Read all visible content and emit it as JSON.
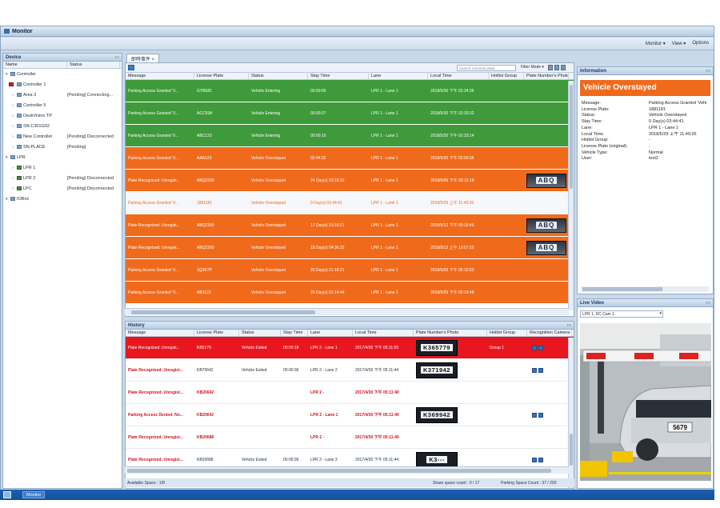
{
  "window": {
    "title": "Monitor"
  },
  "menubar": {
    "items": [
      "Monitor ▾",
      "View ▾",
      "Options"
    ]
  },
  "devices": {
    "title": "Device",
    "columns": [
      "Name",
      "Status"
    ],
    "items": [
      {
        "name": "Controller",
        "status": ""
      },
      {
        "name": "Controller 1",
        "status": ""
      },
      {
        "name": "Area 3",
        "status": "[Pending] Connecting..."
      },
      {
        "name": "Controller 5",
        "status": ""
      },
      {
        "name": "DeskVision TP",
        "status": ""
      },
      {
        "name": "SN-C301G02",
        "status": ""
      },
      {
        "name": "New Controller",
        "status": "[Pending] Disconnected"
      },
      {
        "name": "SN-PLACE",
        "status": "[Pending]"
      },
      {
        "name": "LPR",
        "status": ""
      },
      {
        "name": "LPR 1",
        "status": ""
      },
      {
        "name": "LPR 2",
        "status": "[Pending] Disconnected"
      },
      {
        "name": "LPC",
        "status": "[Pending] Disconnected"
      },
      {
        "name": "IOBox",
        "status": ""
      }
    ]
  },
  "events": {
    "tab_label": "即時事件",
    "search_placeholder": "Search a license plate...",
    "filter_label": "Filter Mode ▾",
    "columns": [
      "Message",
      "License Plate",
      "Status",
      "Stay Time",
      "Lane",
      "Local Time",
      "Hotlist Group",
      "Plate Number's Photo"
    ],
    "rows": [
      {
        "message": "Parking Access Granted 'V...",
        "plate": "GYB581",
        "status": "Vehicle Entering",
        "stay": "00:00:06",
        "lane": "LPR 1 - Lane 1",
        "time": "2018/5/30 下午 02:34:36",
        "color": "green",
        "photo": ""
      },
      {
        "message": "Parking Access Granted 'V...",
        "plate": "ACC59A",
        "status": "Vehicle Entering",
        "stay": "00:00:27",
        "lane": "LPR 1 - Lane 1",
        "time": "2018/5/30 下午 02:33:32",
        "color": "green",
        "photo": ""
      },
      {
        "message": "Parking Access Granted 'V...",
        "plate": "ABC123",
        "status": "Vehicle Entering",
        "stay": "00:00:15",
        "lane": "LPR 1 - Lane 1",
        "time": "2018/5/30 下午 02:33:14",
        "color": "green",
        "photo": ""
      },
      {
        "message": "Parking Access Granted 'V...",
        "plate": "AAA123",
        "status": "Vehicle Overstayed",
        "stay": "02:44:32",
        "lane": "LPR 1 - Lane 1",
        "time": "2018/5/30 下午 02:00:36",
        "color": "orange",
        "photo": ""
      },
      {
        "message": "Plate Recognized: Unregist...",
        "plate": "ABQ2200",
        "status": "Vehicle Overstayed",
        "stay": "24 Day(s) 23:18:32",
        "lane": "LPR 1 - Lane 1",
        "time": "2018/5/06 下午 03:15:18",
        "color": "orange",
        "photo": "ABQ"
      },
      {
        "message": "Parking Access Granted 'V...",
        "plate": "1881181",
        "status": "Vehicle Overstayed",
        "stay": "0 Day(s) 03:44:41",
        "lane": "LPR 1 - Lane 1",
        "time": "2018/5/29 上午 11:49:26",
        "color": "light",
        "photo": ""
      },
      {
        "message": "Plate Recognized: Unregist...",
        "plate": "ABQ2200",
        "status": "Vehicle Overstayed",
        "stay": "17 Day(s) 23:18:21",
        "lane": "LPR 1 - Lane 1",
        "time": "2018/5/12 下午 03:16:46",
        "color": "orange",
        "photo": "ABQ"
      },
      {
        "message": "Plate Recognized: Unregist...",
        "plate": "ABQ2200",
        "status": "Vehicle Overstayed",
        "stay": "18 Day(s) 04:36:32",
        "lane": "LPR 1 - Lane 1",
        "time": "2018/5/12 上午 10:57:20",
        "color": "orange",
        "photo": "ABQ"
      },
      {
        "message": "Parking Access Granted 'V...",
        "plate": "1Q3K7P",
        "status": "Vehicle Overstayed",
        "stay": "20 Day(s) 21:18:21",
        "lane": "LPR 1 - Lane 1",
        "time": "2018/5/09 下午 05:15:52",
        "color": "orange",
        "photo": ""
      },
      {
        "message": "Parking Access Granted 'V...",
        "plate": "ABJ123",
        "status": "Vehicle Overstayed",
        "stay": "20 Day(s) 21:14:44",
        "lane": "LPR 1 - Lane 1",
        "time": "2018/5/09 下午 05:19:48",
        "color": "orange",
        "photo": ""
      }
    ]
  },
  "history": {
    "title": "History",
    "columns": [
      "Message",
      "License Plate",
      "Status",
      "Stay Time",
      "Lane",
      "Local Time",
      "Plate Number's Photo",
      "Hotlist Group",
      "Recognition Camera"
    ],
    "rows": [
      {
        "message": "Plate Recognized: Unregist...",
        "plate": "KB5179",
        "status": "Vehicle Exited",
        "stay": "00:00:18",
        "lane": "LPR 2 - Lane 1",
        "time": "2017/4/30 下午 05:11:55",
        "group": "Group 1",
        "photo": "K365779",
        "style": "red",
        "cam": true
      },
      {
        "message": "Plate Recognized: Unregist...",
        "plate": "KB70642",
        "status": "Vehicle Exited",
        "stay": "00:00:36",
        "lane": "LPR 2 - Lane 2",
        "time": "2017/4/30 下午 05:11:44",
        "group": "",
        "photo": "K371942",
        "style": "normal",
        "cam": true
      },
      {
        "message": "Plate Recognized: Unregist...",
        "plate": "KB20642",
        "status": "",
        "stay": "",
        "lane": "LPR 2 -",
        "time": "2017/4/30 下午 05:11:40",
        "group": "",
        "photo": "",
        "style": "warn",
        "cam": false
      },
      {
        "message": "Parking Access Denied: No...",
        "plate": "KB20642",
        "status": "",
        "stay": "",
        "lane": "LPR 2 - Lane 1",
        "time": "2017/4/30 下午 05:11:40",
        "group": "",
        "photo": "K369942",
        "style": "warn",
        "cam": true
      },
      {
        "message": "Plate Recognized: Unregist...",
        "plate": "KB20688",
        "status": "",
        "stay": "",
        "lane": "LPR 2 -",
        "time": "2017/4/30 下午 05:11:40",
        "group": "",
        "photo": "",
        "style": "warn",
        "cam": false
      },
      {
        "message": "Plate Recognized: Unregist...",
        "plate": "KB20688",
        "status": "Vehicle Exited",
        "stay": "00:00:36",
        "lane": "LPR 2 - Lane 3",
        "time": "2017/4/30 下午 05:11:44",
        "group": "",
        "photo": "K3---",
        "style": "normal",
        "cam": true
      }
    ]
  },
  "information": {
    "title": "Information",
    "banner": "Vehicle Overstayed",
    "fields": [
      {
        "k": "Message:",
        "v": "Parking Access Granted 'Vehi"
      },
      {
        "k": "License Plate:",
        "v": "1881181"
      },
      {
        "k": "Status:",
        "v": "Vehicle Overstayed"
      },
      {
        "k": "Stay Time:",
        "v": "0 Day(s) 03:44:41"
      },
      {
        "k": "Lane:",
        "v": "LPR 1 - Lane 1"
      },
      {
        "k": "Local Time:",
        "v": "2018/5/29 上午 11:49:26"
      },
      {
        "k": "Hotlist Group:",
        "v": "-"
      },
      {
        "k": "License Plate (original):",
        "v": "-"
      },
      {
        "k": "Vehicle Type:",
        "v": "Normal"
      },
      {
        "k": "User:",
        "v": "test2"
      }
    ]
  },
  "live_video": {
    "title": "Live Video",
    "camera": "LPR 1, DC Cam 1",
    "plate_text": "5679"
  },
  "statusbar": {
    "available": "Available Space : 1/8",
    "share": "Share space count : 0 / 17",
    "parking": "Parking Space Count : 37 / 200"
  },
  "taskbar": {
    "task_label": "Monitor"
  },
  "colors": {
    "green": "#3e9a3a",
    "orange": "#f06a1c",
    "red": "#e8161e"
  }
}
